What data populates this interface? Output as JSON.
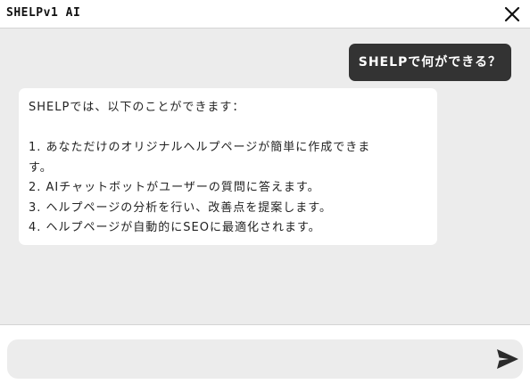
{
  "header": {
    "title": "SHELPv1 AI",
    "close_icon": "close-icon"
  },
  "chat": {
    "user_message": "SHELPで何ができる？",
    "ai_lines": [
      "SHELPでは、以下のことができます：",
      "",
      "1. あなただけのオリジナルヘルプページが簡単に作成できま",
      "す。",
      "2. AIチャットボットがユーザーの質問に答えます。",
      "3. ヘルプページの分析を行い、改善点を提案します。",
      "4. ヘルプページが自動的にSEOに最適化されます。"
    ]
  },
  "input": {
    "value": "",
    "placeholder": "",
    "send_icon": "send-icon"
  },
  "colors": {
    "chat_background": "#ececec",
    "user_bubble": "#333333",
    "ai_bubble": "#ffffff",
    "input_background": "#ececec"
  }
}
